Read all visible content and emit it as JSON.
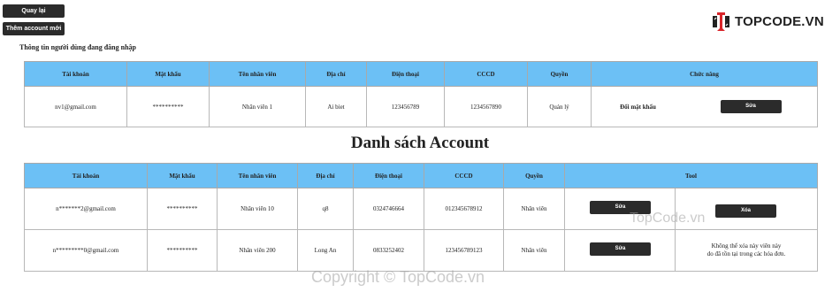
{
  "toolbar": {
    "back_label": "Quay lại",
    "add_label": "Thêm account mới"
  },
  "logo": {
    "text": "TOPCODE.VN",
    "accent": "#d9262b"
  },
  "current_user": {
    "title": "Thông tin người dùng đang đăng nhập",
    "headers": [
      "Tài khoản",
      "Mật khẩu",
      "Tên nhân viên",
      "Địa chỉ",
      "Điện thoại",
      "CCCD",
      "Quyền",
      "Chức năng"
    ],
    "row": {
      "account": "nv1@gmail.com",
      "password": "**********",
      "name": "Nhân viên 1",
      "address": "Ai biet",
      "phone": "123456789",
      "cccd": "1234567890",
      "role": "Quản lý",
      "change_password": "Đổi mật khẩu",
      "edit": "Sửa"
    }
  },
  "accounts": {
    "title": "Danh sách Account",
    "headers": [
      "Tài khoản",
      "Mật khẩu",
      "Tên nhân viên",
      "Địa chỉ",
      "Điện thoại",
      "CCCD",
      "Quyền",
      "Tool"
    ],
    "rows": [
      {
        "account": "n*******2@gmail.com",
        "password": "**********",
        "name": "Nhân viên 10",
        "address": "q8",
        "phone": "0324746664",
        "cccd": "012345678912",
        "role": "Nhân viên",
        "edit": "Sửa",
        "delete": "Xóa"
      },
      {
        "account": "n*********0@gmail.com",
        "password": "**********",
        "name": "Nhân viên 200",
        "address": "Long An",
        "phone": "0833252402",
        "cccd": "123456789123",
        "role": "Nhân viên",
        "edit": "Sửa",
        "note_line1": "Không thể xóa này viên này",
        "note_line2": "do đã tồn tại trong các hóa đơn."
      }
    ]
  },
  "watermarks": {
    "w1": "TopCode.vn",
    "w2": "Copyright © TopCode.vn"
  },
  "colors": {
    "header_bg": "#6cc0f5",
    "button_bg": "#2b2b2b"
  }
}
